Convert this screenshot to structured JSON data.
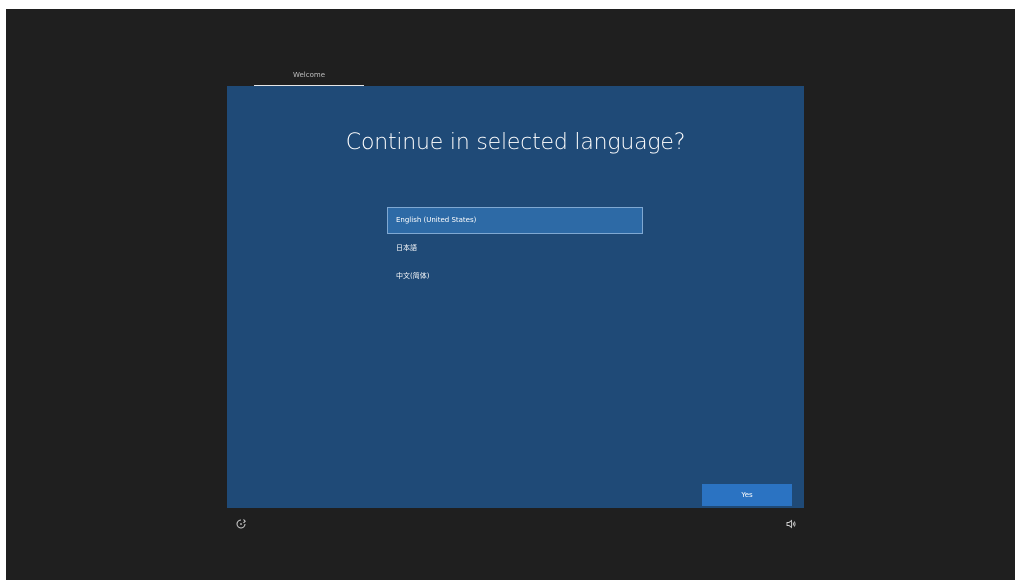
{
  "tabs": [
    {
      "label": "Welcome",
      "active": true
    }
  ],
  "dialog": {
    "title": "Continue in selected language?",
    "languages": [
      {
        "label": "English (United States)",
        "selected": true
      },
      {
        "label": "日本語",
        "selected": false
      },
      {
        "label": "中文(简体)",
        "selected": false
      }
    ],
    "yes_label": "Yes"
  },
  "footer": {
    "left_icon": "accessibility-icon",
    "right_icon": "volume-icon"
  },
  "colors": {
    "screen_bg": "#1f1f1f",
    "panel_bg": "#1f4a77",
    "selected_item_bg": "#2d6aa6",
    "button_bg": "#2b73c2"
  }
}
